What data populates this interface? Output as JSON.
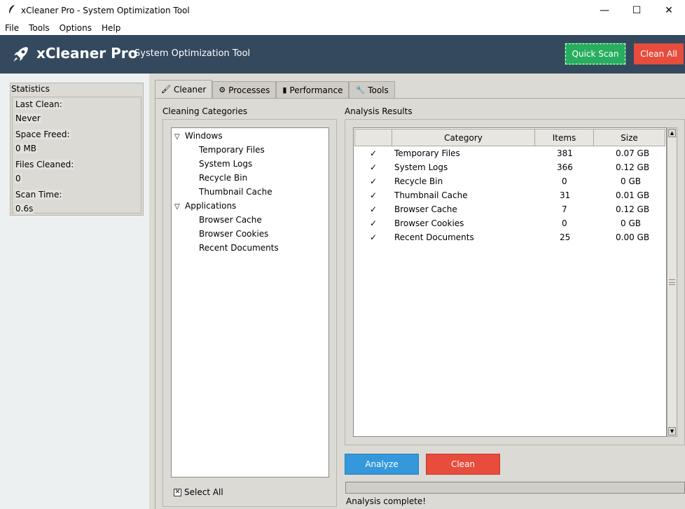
{
  "window": {
    "title": "xCleaner Pro - System Optimization Tool",
    "minimize_glyph": "—",
    "maximize_glyph": "☐",
    "close_glyph": "✕"
  },
  "menu": [
    "File",
    "Tools",
    "Options",
    "Help"
  ],
  "header": {
    "app_name": "xCleaner Pro",
    "subtitle": "System Optimization Tool",
    "quick_scan_label": "Quick Scan",
    "clean_all_label": "Clean All",
    "bg_color": "#34495e",
    "quick_scan_color": "#27ae60",
    "clean_all_color": "#e74c3c"
  },
  "statistics": {
    "title": "Statistics",
    "items": [
      {
        "label": "Last Clean:",
        "value": "Never"
      },
      {
        "label": "Space Freed:",
        "value": "0 MB"
      },
      {
        "label": "Files Cleaned:",
        "value": "0"
      },
      {
        "label": "Scan Time:",
        "value": "0.6s"
      }
    ]
  },
  "tabs": [
    {
      "label": "Cleaner",
      "icon": "brush-icon",
      "glyph": "🖌",
      "active": true
    },
    {
      "label": "Processes",
      "icon": "gear-icon",
      "glyph": "⚙",
      "active": false
    },
    {
      "label": "Performance",
      "icon": "chart-icon",
      "glyph": "▮",
      "active": false
    },
    {
      "label": "Tools",
      "icon": "wrench-icon",
      "glyph": "🔧",
      "active": false
    }
  ],
  "cleaner": {
    "categories_label": "Cleaning Categories",
    "results_label": "Analysis Results",
    "tree": [
      {
        "group": "Windows",
        "expanded": true,
        "items": [
          "Temporary Files",
          "System Logs",
          "Recycle Bin",
          "Thumbnail Cache"
        ]
      },
      {
        "group": "Applications",
        "expanded": true,
        "items": [
          "Browser Cache",
          "Browser Cookies",
          "Recent Documents"
        ]
      }
    ],
    "tree_toggle_glyph": "▽",
    "select_all_label": "Select All",
    "select_all_checked": true,
    "table": {
      "columns": [
        "",
        "Category",
        "Items",
        "Size"
      ],
      "rows": [
        {
          "check": "✓",
          "category": "Temporary Files",
          "items": "381",
          "size": "0.07 GB"
        },
        {
          "check": "✓",
          "category": "System Logs",
          "items": "366",
          "size": "0.12 GB"
        },
        {
          "check": "✓",
          "category": "Recycle Bin",
          "items": "0",
          "size": "0 GB"
        },
        {
          "check": "✓",
          "category": "Thumbnail Cache",
          "items": "31",
          "size": "0.01 GB"
        },
        {
          "check": "✓",
          "category": "Browser Cache",
          "items": "7",
          "size": "0.12 GB"
        },
        {
          "check": "✓",
          "category": "Browser Cookies",
          "items": "0",
          "size": "0 GB"
        },
        {
          "check": "✓",
          "category": "Recent Documents",
          "items": "25",
          "size": "0.00 GB"
        }
      ]
    },
    "analyze_label": "Analyze",
    "clean_label": "Clean",
    "analyze_color": "#3498db",
    "clean_color": "#e74c3c",
    "progress": 0,
    "status": "Analysis complete!"
  }
}
